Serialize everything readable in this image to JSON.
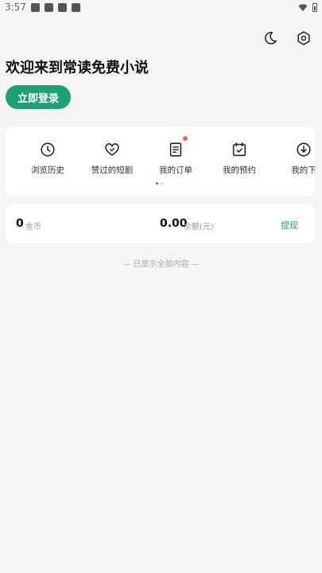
{
  "status_bar": {
    "time": "3:57"
  },
  "welcome": "欢迎来到常读免费小说",
  "login_label": "立即登录",
  "shortcuts": [
    {
      "label": "浏览历史",
      "icon": "clock-icon",
      "badge": false
    },
    {
      "label": "赞过的短剧",
      "icon": "heart-icon",
      "badge": false
    },
    {
      "label": "我的订单",
      "icon": "order-icon",
      "badge": true
    },
    {
      "label": "我的预约",
      "icon": "calendar-check-icon",
      "badge": false
    },
    {
      "label": "我的下",
      "icon": "download-icon",
      "badge": false
    }
  ],
  "balance": {
    "coins": "0",
    "coins_unit": "金币",
    "money": "0.00",
    "money_unit": "余额(元)",
    "withdraw_label": "提现"
  },
  "end_text": "— 已显示全部内容 —",
  "colors": {
    "accent": "#1aa276",
    "badge": "#f26b3a",
    "background": "#f5f5f5"
  }
}
